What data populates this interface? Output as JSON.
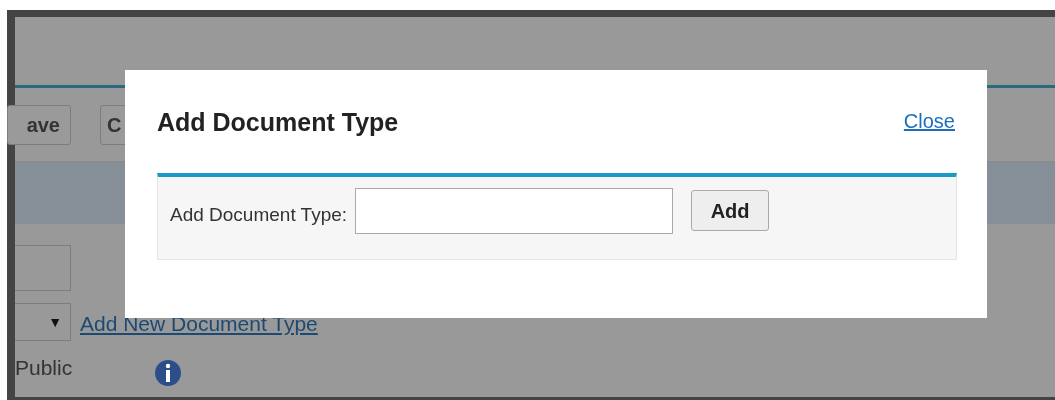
{
  "background_page": {
    "toolbar_buttons": [
      "ave",
      "C"
    ],
    "dropdown_arrow": "▼",
    "link": "Add New Document Type",
    "field_label": "Public"
  },
  "dialog": {
    "title": "Add Document Type",
    "close_link": "Close",
    "field_label": "Add Document Type:",
    "button": "Add"
  }
}
